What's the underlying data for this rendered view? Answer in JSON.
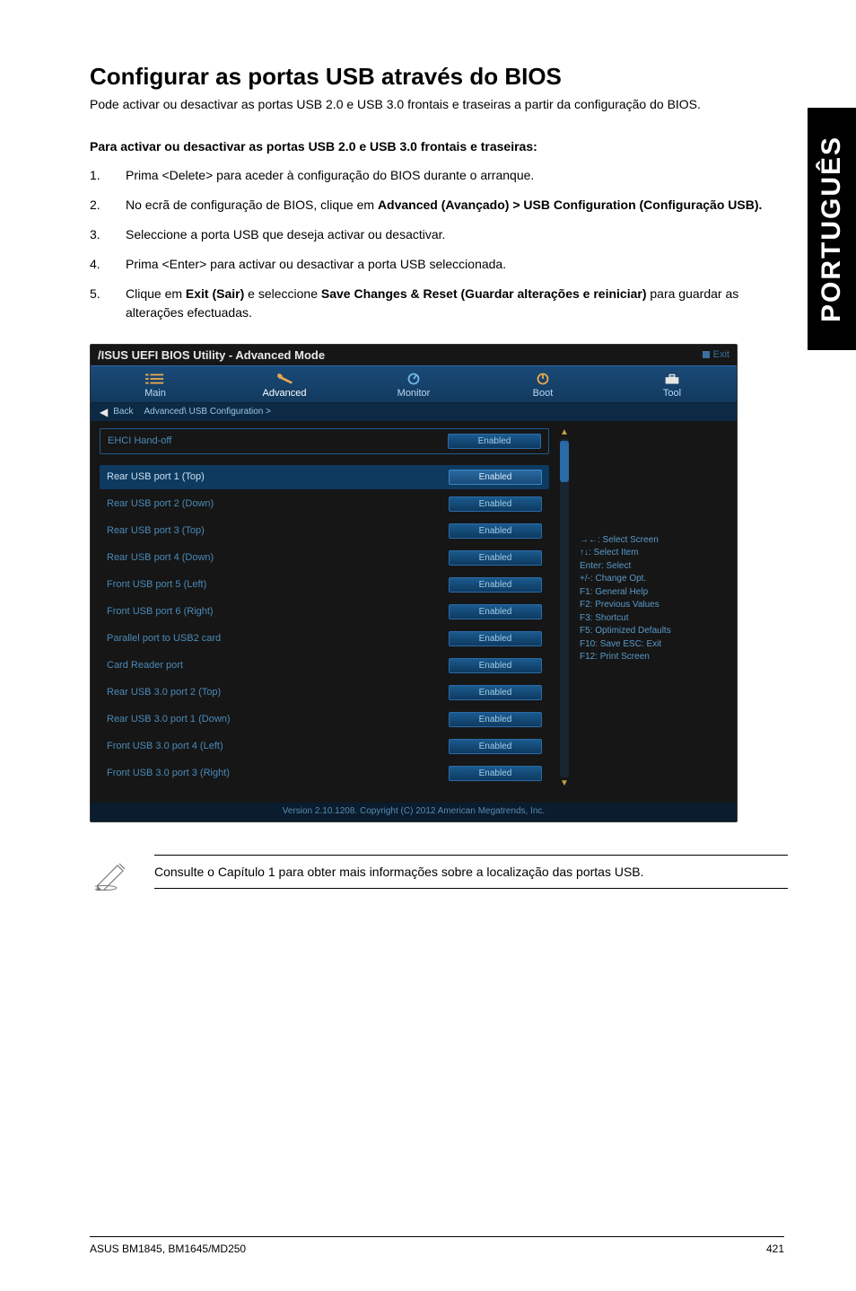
{
  "sidetab": "PORTUGUÊS",
  "title": "Configurar as portas USB através do BIOS",
  "intro": "Pode activar ou desactivar as portas USB 2.0 e USB 3.0 frontais e traseiras a partir da configuração do BIOS.",
  "subhead": "Para activar ou desactivar as portas USB 2.0 e USB 3.0 frontais e traseiras:",
  "steps": {
    "s1": "Prima <Delete> para aceder à configuração do BIOS durante o arranque.",
    "s2_pre": "No ecrã de configuração de BIOS, clique em ",
    "s2_bold": "Advanced (Avançado) > USB Configuration (Configuração USB).",
    "s3": "Seleccione a porta USB que deseja activar ou desactivar.",
    "s4": "Prima <Enter> para activar ou desactivar a porta USB seleccionada.",
    "s5_pre": "Clique em ",
    "s5_b1": "Exit (Sair)",
    "s5_mid": " e seleccione ",
    "s5_b2": "Save Changes & Reset (Guardar alterações e reiniciar)",
    "s5_post": " para guardar as alterações efectuadas."
  },
  "bios": {
    "titlebar": "/ISUS UEFI BIOS Utility - Advanced Mode",
    "titlebar_right": "Exit",
    "tabs": {
      "main": "Main",
      "advanced": "Advanced",
      "monitor": "Monitor",
      "boot": "Boot",
      "tool": "Tool"
    },
    "breadcrumb_back": "Back",
    "breadcrumb": "Advanced\\ USB Configuration >",
    "rows": [
      {
        "label": "EHCI Hand-off",
        "value": "Enabled"
      },
      {
        "label": "Rear USB port 1 (Top)",
        "value": "Enabled",
        "highlight": true
      },
      {
        "label": "Rear USB port 2 (Down)",
        "value": "Enabled"
      },
      {
        "label": "Rear USB port 3 (Top)",
        "value": "Enabled"
      },
      {
        "label": "Rear USB port 4 (Down)",
        "value": "Enabled"
      },
      {
        "label": "Front USB port 5 (Left)",
        "value": "Enabled"
      },
      {
        "label": "Front USB port 6 (Right)",
        "value": "Enabled"
      },
      {
        "label": "Parallel port to USB2 card",
        "value": "Enabled"
      },
      {
        "label": "Card Reader port",
        "value": "Enabled"
      },
      {
        "label": "Rear USB 3.0 port 2 (Top)",
        "value": "Enabled"
      },
      {
        "label": "Rear USB 3.0 port 1 (Down)",
        "value": "Enabled"
      },
      {
        "label": "Front USB 3.0 port 4 (Left)",
        "value": "Enabled"
      },
      {
        "label": "Front USB 3.0 port 3 (Right)",
        "value": "Enabled"
      }
    ],
    "help": [
      "→←: Select Screen",
      "↑↓: Select Item",
      "Enter: Select",
      "+/-: Change Opt.",
      "F1: General Help",
      "F2: Previous Values",
      "F3: Shortcut",
      "F5: Optimized Defaults",
      "F10: Save  ESC: Exit",
      "F12: Print Screen"
    ],
    "footer": "Version 2.10.1208. Copyright (C) 2012 American Megatrends, Inc."
  },
  "note_text": "Consulte o Capítulo 1 para obter mais informações sobre a localização das portas USB.",
  "footer_left": "ASUS BM1845, BM1645/MD250",
  "footer_right": "421"
}
